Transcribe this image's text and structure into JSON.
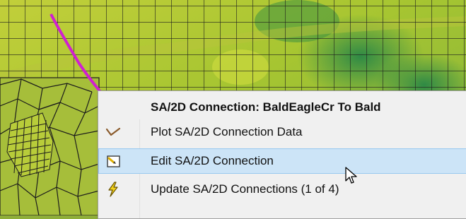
{
  "context_menu": {
    "header": "SA/2D Connection: BaldEagleCr To Bald",
    "items": [
      {
        "label": "Plot SA/2D Connection Data",
        "icon": "profile-plot-icon"
      },
      {
        "label": "Edit SA/2D Connection",
        "icon": "edit-connection-icon",
        "highlighted": true
      },
      {
        "label": "Update SA/2D Connections  (1 of 4)",
        "icon": "lightning-icon"
      }
    ]
  },
  "map": {
    "terrain_colors": [
      "#c8d62a",
      "#9bbf36",
      "#4c9a3c",
      "#2f7f3f"
    ],
    "mesh_color": "#222222",
    "connection_line_color": "#cc22cc"
  }
}
